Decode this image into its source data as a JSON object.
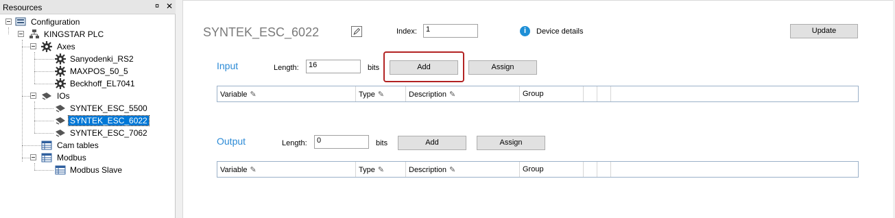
{
  "resources": {
    "title": "Resources",
    "pin_glyph": "¤",
    "close_glyph": "✕",
    "tree": {
      "configuration": "Configuration",
      "plc": "KINGSTAR PLC",
      "axes": "Axes",
      "axis_items": [
        "Sanyodenki_RS2",
        "MAXPOS_50_5",
        "Beckhoff_EL7041"
      ],
      "ios": "IOs",
      "io_items": [
        "SYNTEK_ESC_5500",
        "SYNTEK_ESC_6022",
        "SYNTEK_ESC_7062"
      ],
      "selected": "SYNTEK_ESC_6022",
      "cam_tables": "Cam tables",
      "modbus": "Modbus",
      "modbus_items": [
        "Modbus Slave"
      ]
    }
  },
  "device": {
    "name": "SYNTEK_ESC_6022",
    "index_label": "Index:",
    "index_value": "1",
    "info_glyph": "i",
    "details_label": "Device details",
    "update_label": "Update"
  },
  "input": {
    "title": "Input",
    "length_label": "Length:",
    "length_value": "16",
    "bits_label": "bits",
    "add_label": "Add",
    "assign_label": "Assign",
    "columns": [
      "Variable",
      "Type",
      "Description",
      "Group"
    ]
  },
  "output": {
    "title": "Output",
    "length_label": "Length:",
    "length_value": "0",
    "bits_label": "bits",
    "add_label": "Add",
    "assign_label": "Assign",
    "columns": [
      "Variable",
      "Type",
      "Description",
      "Group"
    ]
  },
  "pencil_glyph": "✎",
  "colors": {
    "accent": "#2b8ad6",
    "selection": "#0078d7",
    "highlight": "#b22222",
    "info": "#1e8fd6"
  }
}
